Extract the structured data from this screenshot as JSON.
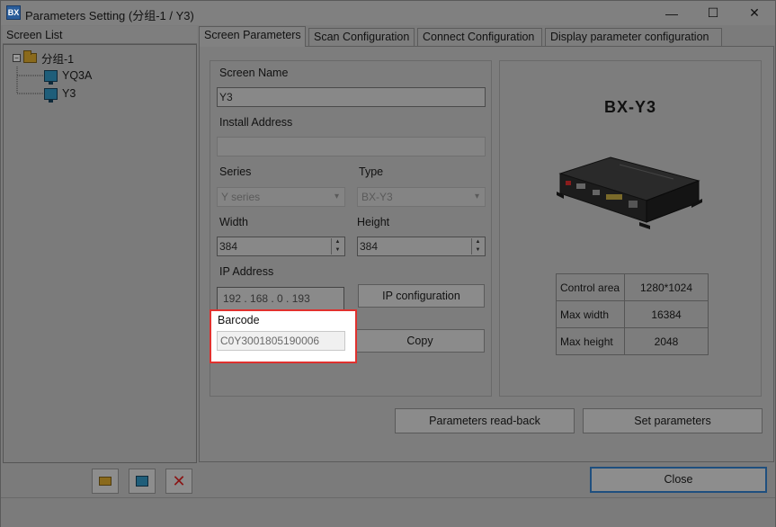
{
  "window": {
    "title": "Parameters Setting   (分组-1 / Y3)",
    "app_icon_text": "BX",
    "minimize_glyph": "—",
    "maximize_glyph": "☐",
    "close_glyph": "✕"
  },
  "screen_list": {
    "header": "Screen List",
    "group": {
      "expander": "−",
      "label": "分组-1"
    },
    "items": [
      {
        "label": "YQ3A"
      },
      {
        "label": "Y3"
      }
    ]
  },
  "tabs": [
    {
      "label": "Screen Parameters",
      "active": true
    },
    {
      "label": "Scan Configuration",
      "active": false
    },
    {
      "label": "Connect Configuration",
      "active": false
    },
    {
      "label": "Display parameter configuration",
      "active": false
    }
  ],
  "form": {
    "screen_name_label": "Screen Name",
    "screen_name_value": "Y3",
    "install_address_label": "Install Address",
    "install_address_value": "",
    "series_label": "Series",
    "series_value": "Y series",
    "type_label": "Type",
    "type_value": "BX-Y3",
    "width_label": "Width",
    "width_value": "384",
    "height_label": "Height",
    "height_value": "384",
    "ip_label": "IP Address",
    "ip_value": "192 . 168 .   0  . 193",
    "ip_config_button": "IP configuration",
    "barcode_label": "Barcode",
    "barcode_value": "C0Y3001805190006",
    "copy_button": "Copy"
  },
  "device": {
    "model": "BX-Y3",
    "specs": [
      {
        "key": "Control area",
        "value": "1280*1024"
      },
      {
        "key": "Max width",
        "value": "16384"
      },
      {
        "key": "Max height",
        "value": "2048"
      }
    ]
  },
  "actions": {
    "readback": "Parameters read-back",
    "set": "Set parameters",
    "close": "Close"
  },
  "colors": {
    "highlight_border": "#e0312e",
    "overlay": "#7b7b7b",
    "close_focus": "#1f4f7e"
  }
}
